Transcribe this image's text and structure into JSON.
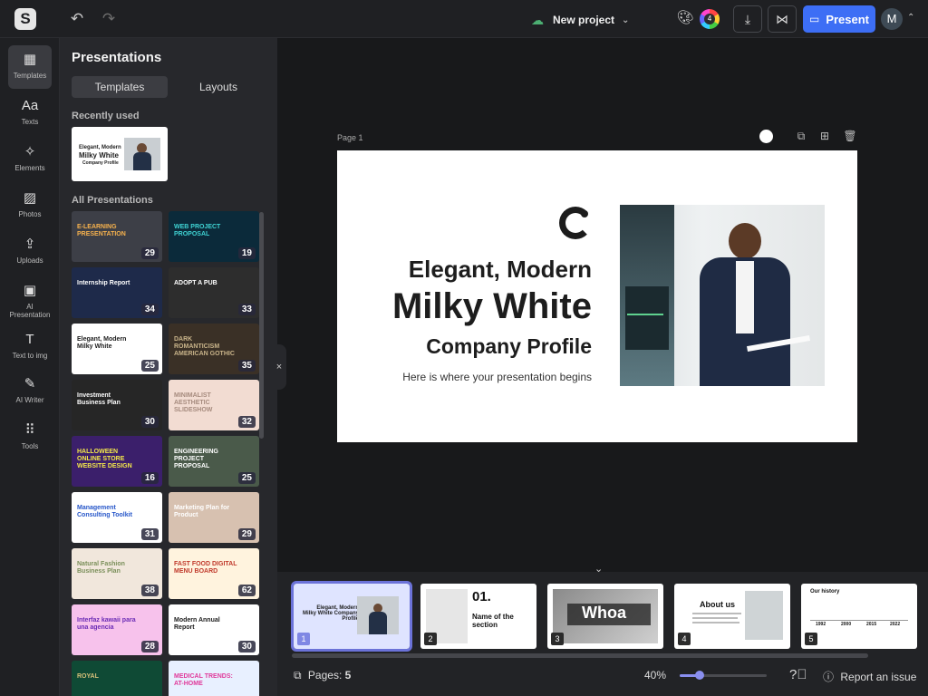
{
  "topbar": {
    "logo": "S",
    "undo_icon": "undo-icon",
    "redo_icon": "redo-icon",
    "project_name": "New project",
    "colorwheel_count": "4",
    "present_label": "Present",
    "avatar_initial": "M"
  },
  "rail": {
    "items": [
      {
        "label": "Templates",
        "icon": "▦"
      },
      {
        "label": "Texts",
        "icon": "Aa"
      },
      {
        "label": "Elements",
        "icon": "✧"
      },
      {
        "label": "Photos",
        "icon": "▨"
      },
      {
        "label": "Uploads",
        "icon": "⇪"
      },
      {
        "label": "AI Presentation",
        "icon": "▣"
      },
      {
        "label": "Text to img",
        "icon": "T"
      },
      {
        "label": "AI Writer",
        "icon": "✎"
      },
      {
        "label": "Tools",
        "icon": "⠿"
      }
    ]
  },
  "panel": {
    "title": "Presentations",
    "tabs": [
      "Templates",
      "Layouts"
    ],
    "recently_used_label": "Recently used",
    "all_label": "All Presentations",
    "recent": {
      "line1": "Elegant, Modern",
      "line2": "Milky White",
      "line3": "Company Profile"
    },
    "templates": [
      {
        "title": "E-LEARNING PRESENTATION",
        "count": "29",
        "bg": "#3d3f47",
        "fg": "#f7b24d"
      },
      {
        "title": "WEB PROJECT PROPOSAL",
        "count": "19",
        "bg": "#0b2a3a",
        "fg": "#3fd3d3"
      },
      {
        "title": "Internship Report",
        "count": "34",
        "bg": "#1e2a4a",
        "fg": "#ffffff"
      },
      {
        "title": "ADOPT A PUB",
        "count": "33",
        "bg": "#2d2d2d",
        "fg": "#ffffff"
      },
      {
        "title": "Elegant, Modern Milky White",
        "count": "25",
        "bg": "#ffffff",
        "fg": "#1d1d1d"
      },
      {
        "title": "DARK ROMANTICISM AMERICAN GOTHIC",
        "count": "35",
        "bg": "#3a3026",
        "fg": "#c9b48a"
      },
      {
        "title": "Investment Business Plan",
        "count": "30",
        "bg": "#262626",
        "fg": "#ffffff"
      },
      {
        "title": "MINIMALIST AESTHETIC SLIDESHOW",
        "count": "32",
        "bg": "#f2dcd2",
        "fg": "#a68b7e"
      },
      {
        "title": "HALLOWEEN ONLINE STORE WEBSITE DESIGN",
        "count": "16",
        "bg": "#3b1f6b",
        "fg": "#f5e94a"
      },
      {
        "title": "ENGINEERING PROJECT PROPOSAL",
        "count": "25",
        "bg": "#4a5a4a",
        "fg": "#ffffff"
      },
      {
        "title": "Management Consulting Toolkit",
        "count": "31",
        "bg": "#ffffff",
        "fg": "#2656c9"
      },
      {
        "title": "Marketing Plan for Product",
        "count": "29",
        "bg": "#d7c1b0",
        "fg": "#ffffff"
      },
      {
        "title": "Natural Fashion Business Plan",
        "count": "38",
        "bg": "#f1e7dc",
        "fg": "#7a8f5a"
      },
      {
        "title": "FAST FOOD DIGITAL MENU BOARD",
        "count": "62",
        "bg": "#fff3de",
        "fg": "#c0392b"
      },
      {
        "title": "Interfaz kawaii para una agencia",
        "count": "28",
        "bg": "#f7c2ec",
        "fg": "#6b2bb5"
      },
      {
        "title": "Modern Annual Report",
        "count": "30",
        "bg": "#ffffff",
        "fg": "#1d1d1d"
      },
      {
        "title": "ROYAL",
        "count": "",
        "bg": "#0f4a35",
        "fg": "#d7c07a"
      },
      {
        "title": "MEDICAL TRENDS: AT-HOME",
        "count": "",
        "bg": "#e8f0ff",
        "fg": "#e0399a"
      }
    ]
  },
  "canvas": {
    "page_label": "Page 1",
    "slide": {
      "line1": "Elegant, Modern",
      "line2": "Milky White",
      "line3": "Company Profile",
      "tagline": "Here is where your presentation begins"
    }
  },
  "pages": [
    {
      "num": "1",
      "title": "Elegant, Modern Milky White Company Profile"
    },
    {
      "num": "2",
      "title": "01.",
      "sub": "Name of the section"
    },
    {
      "num": "3",
      "title": "Whoa"
    },
    {
      "num": "4",
      "title": "About us"
    },
    {
      "num": "5",
      "title": "Our history",
      "years": [
        "1992",
        "2000",
        "2015",
        "2022"
      ]
    }
  ],
  "footer": {
    "pages_label": "Pages:",
    "pages_count": "5",
    "zoom": "40%",
    "zoom_fraction": 0.23,
    "report_label": "Report an issue"
  }
}
